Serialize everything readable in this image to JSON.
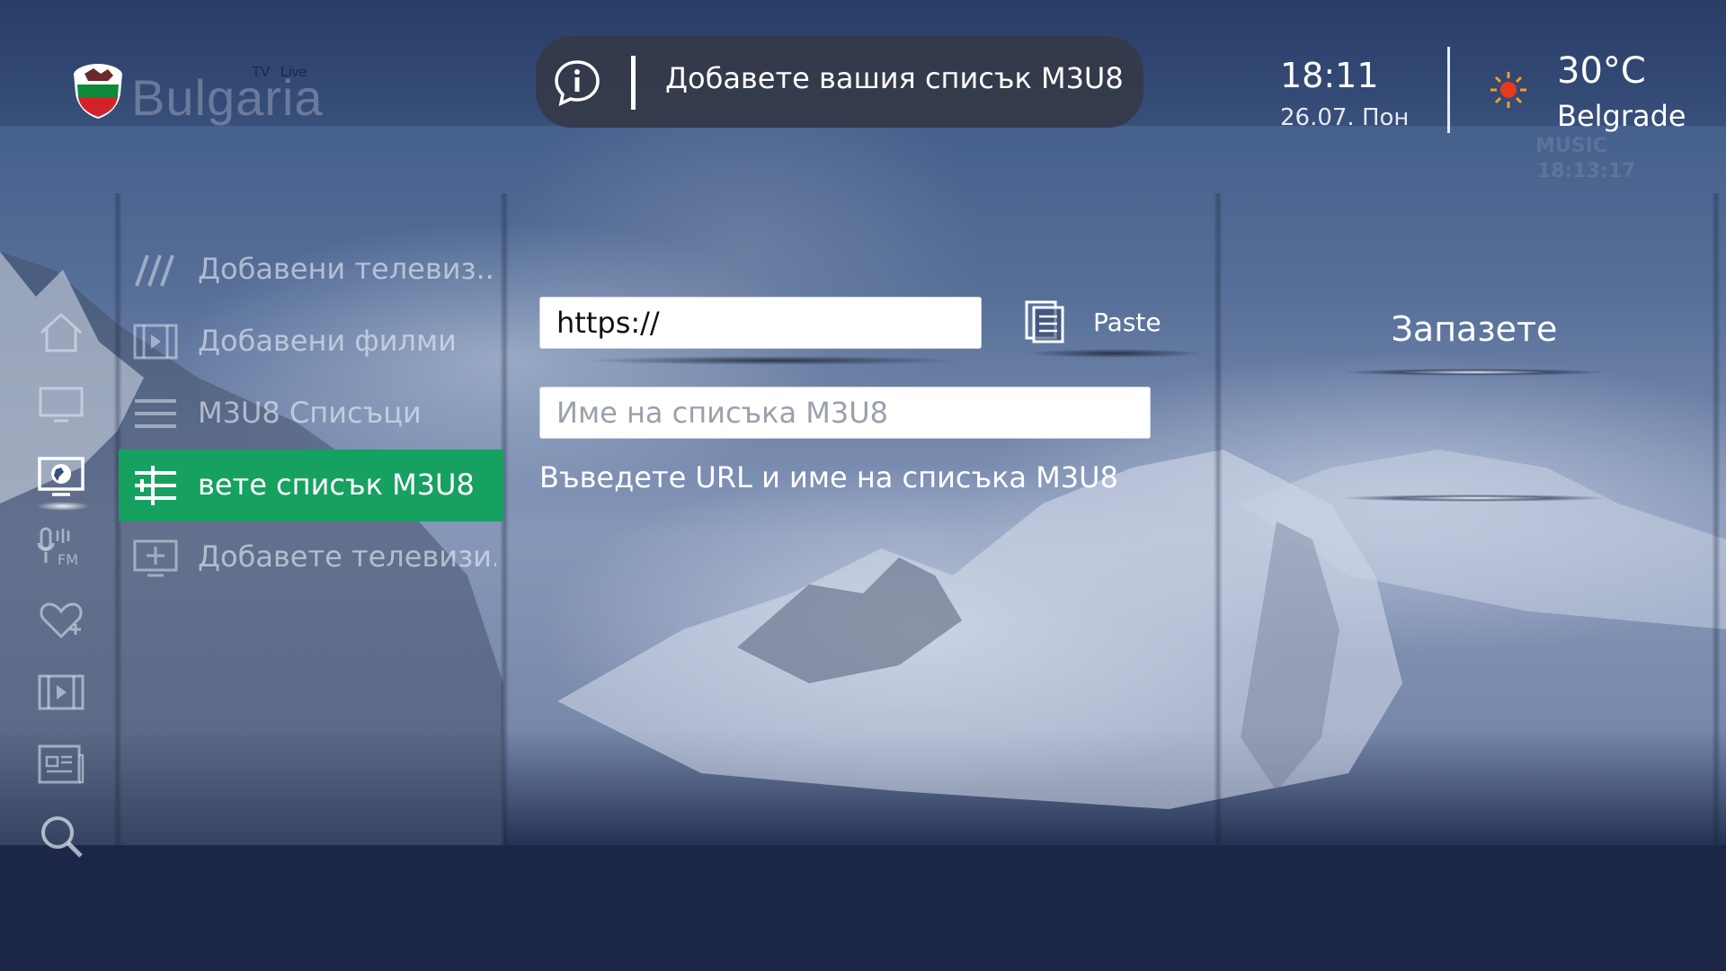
{
  "logo": {
    "word": "Bulgaria",
    "tv": "TV",
    "live": "Live"
  },
  "banner": {
    "text": "Добавете вашия списък M3U8"
  },
  "clock": {
    "time": "18:11",
    "date": "26.07. Пон"
  },
  "weather": {
    "temp": "30°C",
    "city": "Belgrade",
    "watermark_line1": "MUSIC",
    "watermark_line2": "18:13:17"
  },
  "rail": {
    "items": [
      {
        "icon": "home-icon"
      },
      {
        "icon": "tv-icon"
      },
      {
        "icon": "globe-tv-icon",
        "active": true
      },
      {
        "icon": "fm-radio-icon"
      },
      {
        "icon": "heart-plus-icon"
      },
      {
        "icon": "film-icon"
      },
      {
        "icon": "news-icon"
      },
      {
        "icon": "search-icon"
      }
    ]
  },
  "submenu": {
    "items": [
      {
        "label": "Добавени телевиз..",
        "icon": "slashes-icon"
      },
      {
        "label": "Добавени филми",
        "icon": "film-icon"
      },
      {
        "label": "M3U8 Списъци",
        "icon": "list-icon"
      },
      {
        "label": "вете списък M3U8",
        "icon": "add-list-icon",
        "active": true
      },
      {
        "label": "Добавете телевизи..",
        "icon": "add-tv-icon"
      }
    ]
  },
  "form": {
    "url_value": "https://",
    "name_placeholder": "Име на списъка M3U8",
    "paste_label": "Paste",
    "hint": "Въведете URL и име на списъка M3U8",
    "save_label": "Запазете"
  },
  "colors": {
    "accent": "#16a160",
    "banner_bg": "#343a48",
    "bottom_bar": "#1c2748"
  }
}
